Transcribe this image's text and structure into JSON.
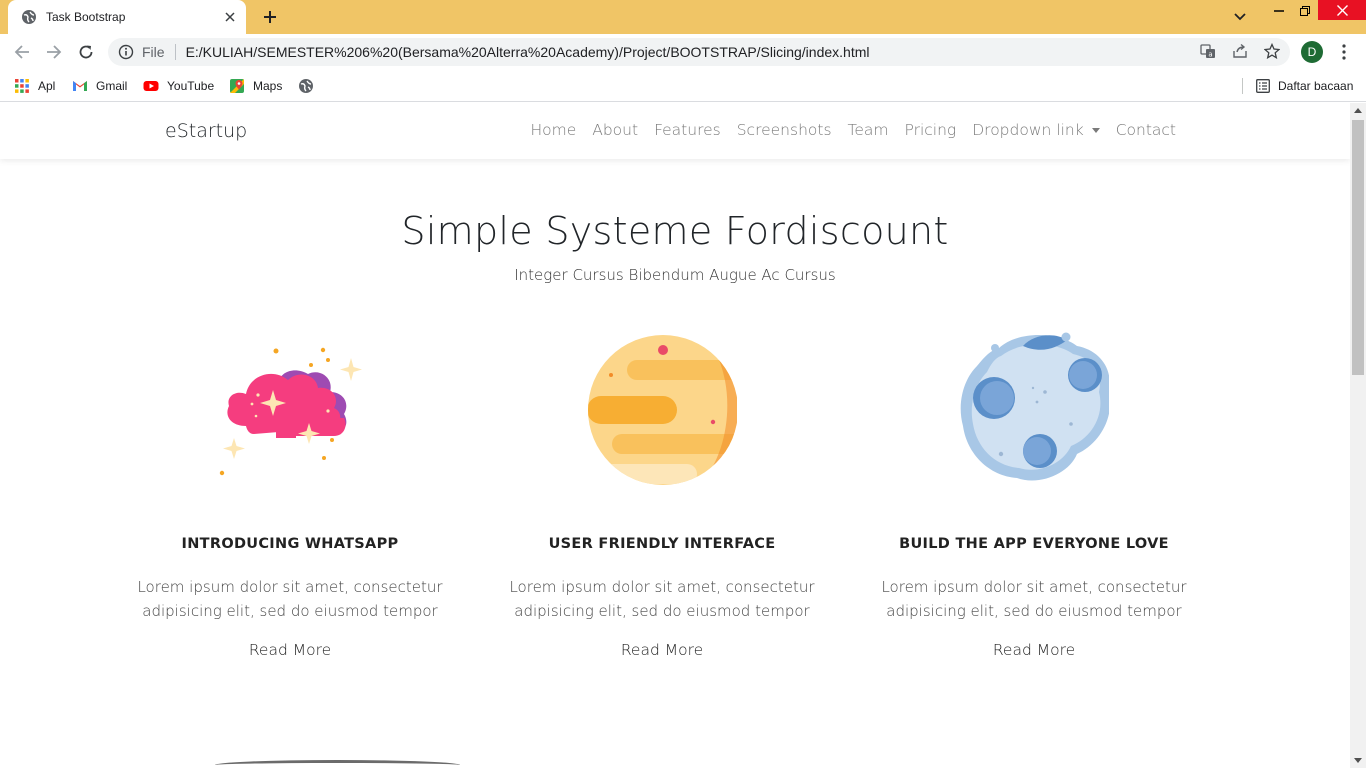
{
  "browser": {
    "tab_title": "Task Bootstrap",
    "scheme_label": "File",
    "url": "E:/KULIAH/SEMESTER%206%20(Bersama%20Alterra%20Academy)/Project/BOOTSTRAP/Slicing/index.html",
    "profile_initial": "D",
    "bookmarks": [
      {
        "label": "Apl",
        "icon": "apps-grid-icon"
      },
      {
        "label": "Gmail",
        "icon": "gmail-icon"
      },
      {
        "label": "YouTube",
        "icon": "youtube-icon"
      },
      {
        "label": "Maps",
        "icon": "maps-icon"
      }
    ],
    "reading_list_label": "Daftar bacaan"
  },
  "site": {
    "brand": "eStartup",
    "menu": [
      "Home",
      "About",
      "Features",
      "Screenshots",
      "Team",
      "Pricing",
      "Dropdown link",
      "Contact"
    ],
    "hero": {
      "title": "Simple Systeme Fordiscount",
      "subtitle": "Integer Cursus Bibendum Augue Ac Cursus"
    },
    "features": [
      {
        "title": "INTRODUCING WHATSAPP",
        "text": "Lorem ipsum dolor sit amet, consectetur adipisicing elit, sed do eiusmod tempor",
        "link": "Read More",
        "illustration": "cloud-stars-icon"
      },
      {
        "title": "USER FRIENDLY INTERFACE",
        "text": "Lorem ipsum dolor sit amet, consectetur adipisicing elit, sed do eiusmod tempor",
        "link": "Read More",
        "illustration": "planet-icon"
      },
      {
        "title": "BUILD THE APP EVERYONE LOVE",
        "text": "Lorem ipsum dolor sit amet, consectetur adipisicing elit, sed do eiusmod tempor",
        "link": "Read More",
        "illustration": "moon-icon"
      }
    ]
  },
  "colors": {
    "tabstrip": "#f0c566",
    "close_button": "#e81123",
    "profile": "#1e6b34",
    "nav_link": "#7a7a7a"
  }
}
